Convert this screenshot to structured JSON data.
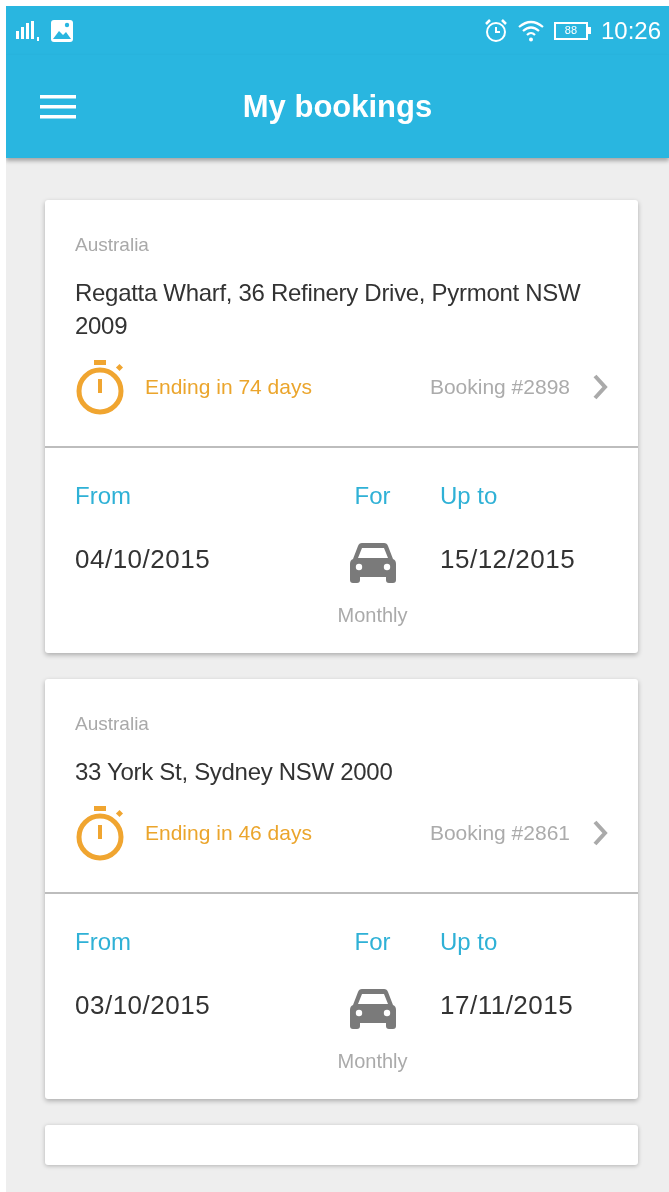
{
  "status_bar": {
    "battery": "88",
    "time": "10:26"
  },
  "app_bar": {
    "title": "My bookings"
  },
  "bookings": [
    {
      "country": "Australia",
      "address": "Regatta Wharf, 36 Refinery Drive, Pyrmont NSW 2009",
      "ending": "Ending in 74 days",
      "booking": "Booking #2898",
      "from_label": "From",
      "from": "04/10/2015",
      "for_label": "For",
      "period": "Monthly",
      "upto_label": "Up to",
      "upto": "15/12/2015"
    },
    {
      "country": "Australia",
      "address": "33 York St, Sydney NSW 2000",
      "ending": "Ending in 46 days",
      "booking": "Booking #2861",
      "from_label": "From",
      "from": "03/10/2015",
      "for_label": "For",
      "period": "Monthly",
      "upto_label": "Up to",
      "upto": "17/11/2015"
    }
  ]
}
